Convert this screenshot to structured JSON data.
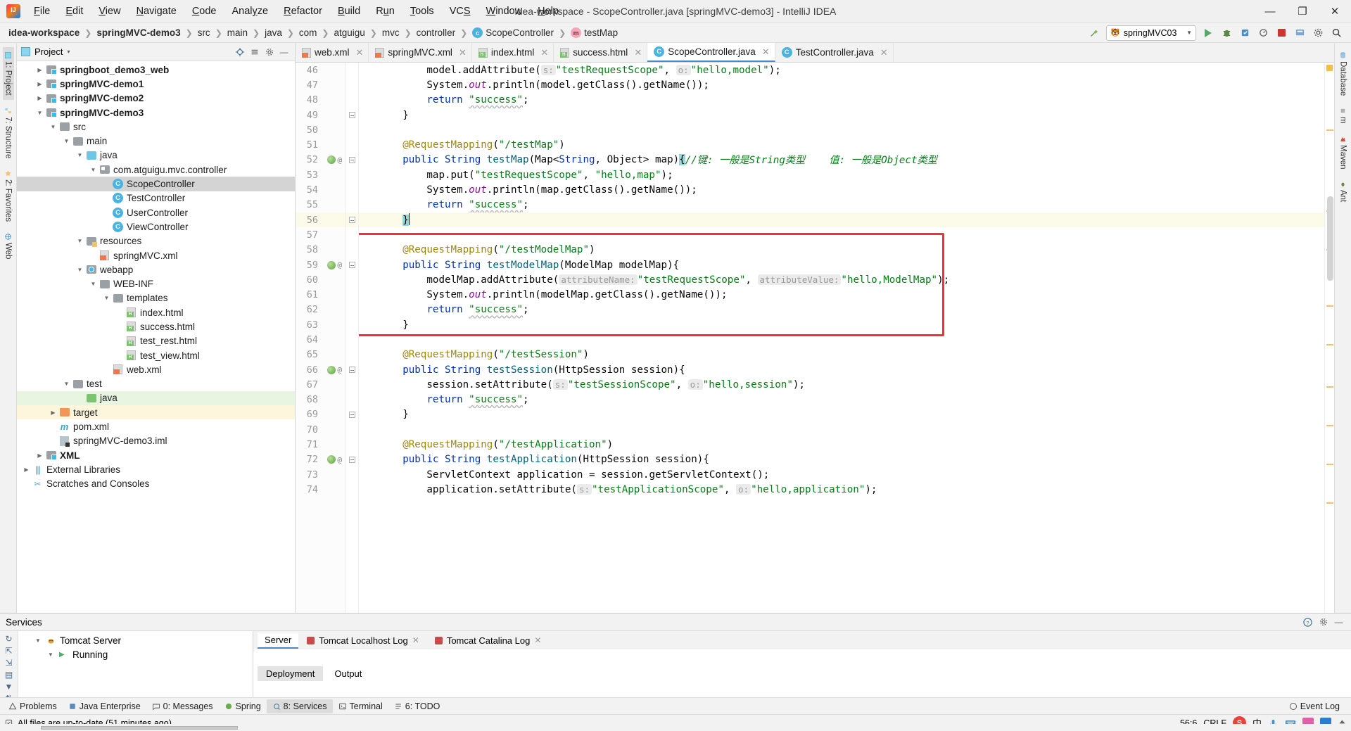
{
  "window": {
    "title": "idea-workspace - ScopeController.java [springMVC-demo3] - IntelliJ IDEA",
    "minimize": "—",
    "maximize": "❐",
    "close": "✕"
  },
  "menu": [
    {
      "label": "File"
    },
    {
      "label": "Edit"
    },
    {
      "label": "View"
    },
    {
      "label": "Navigate"
    },
    {
      "label": "Code"
    },
    {
      "label": "Analyze"
    },
    {
      "label": "Refactor"
    },
    {
      "label": "Build"
    },
    {
      "label": "Run"
    },
    {
      "label": "Tools"
    },
    {
      "label": "VCS"
    },
    {
      "label": "Window"
    },
    {
      "label": "Help"
    }
  ],
  "breadcrumb": [
    {
      "label": "idea-workspace",
      "bold": true,
      "icon": ""
    },
    {
      "label": "springMVC-demo3",
      "bold": true,
      "icon": ""
    },
    {
      "label": "src",
      "bold": false,
      "icon": ""
    },
    {
      "label": "main",
      "bold": false,
      "icon": ""
    },
    {
      "label": "java",
      "bold": false,
      "icon": ""
    },
    {
      "label": "com",
      "bold": false,
      "icon": ""
    },
    {
      "label": "atguigu",
      "bold": false,
      "icon": ""
    },
    {
      "label": "mvc",
      "bold": false,
      "icon": ""
    },
    {
      "label": "controller",
      "bold": false,
      "icon": ""
    },
    {
      "label": "ScopeController",
      "bold": false,
      "icon": "c"
    },
    {
      "label": "testMap",
      "bold": false,
      "icon": "m"
    }
  ],
  "toolbar": {
    "run_config": "springMVC03",
    "run_config_icon": "tomcat-icon",
    "build_icon": "hammer-icon",
    "run_icon": "run-button",
    "debug_icon": "debug-button",
    "coverage_icon": "coverage-button",
    "profile_icon": "profile-button",
    "stop_icon": "stop-button",
    "update_icon": "update-button",
    "settings_icon": "settings-button",
    "search_icon": "search-button"
  },
  "left_rail": [
    {
      "label": "1: Project",
      "active": true,
      "name": "tool-project"
    },
    {
      "label": "7: Structure",
      "active": false,
      "name": "tool-structure"
    },
    {
      "label": "2: Favorites",
      "active": false,
      "name": "tool-favorites"
    },
    {
      "label": "Web",
      "active": false,
      "name": "tool-web"
    }
  ],
  "right_rail": [
    {
      "label": "Database",
      "name": "tool-database"
    },
    {
      "label": "m",
      "name": "tool-m"
    },
    {
      "label": "Maven",
      "name": "tool-maven"
    },
    {
      "label": "Ant",
      "name": "tool-ant"
    }
  ],
  "project_panel": {
    "title": "Project",
    "caret": "▾",
    "tree": [
      {
        "label": "springboot_demo3_web",
        "indent": 1,
        "arrow": "▶",
        "icon": "module",
        "bold": true,
        "state": ""
      },
      {
        "label": "springMVC-demo1",
        "indent": 1,
        "arrow": "▶",
        "icon": "module",
        "bold": true,
        "state": ""
      },
      {
        "label": "springMVC-demo2",
        "indent": 1,
        "arrow": "▶",
        "icon": "module",
        "bold": true,
        "state": ""
      },
      {
        "label": "springMVC-demo3",
        "indent": 1,
        "arrow": "▼",
        "icon": "module",
        "bold": true,
        "state": ""
      },
      {
        "label": "src",
        "indent": 2,
        "arrow": "▼",
        "icon": "folder-gray",
        "bold": false,
        "state": ""
      },
      {
        "label": "main",
        "indent": 3,
        "arrow": "▼",
        "icon": "folder-gray",
        "bold": false,
        "state": ""
      },
      {
        "label": "java",
        "indent": 4,
        "arrow": "▼",
        "icon": "folder-blue",
        "bold": false,
        "state": ""
      },
      {
        "label": "com.atguigu.mvc.controller",
        "indent": 5,
        "arrow": "▼",
        "icon": "package",
        "bold": false,
        "state": ""
      },
      {
        "label": "ScopeController",
        "indent": 6,
        "arrow": "",
        "icon": "class",
        "bold": false,
        "state": "selected"
      },
      {
        "label": "TestController",
        "indent": 6,
        "arrow": "",
        "icon": "class",
        "bold": false,
        "state": ""
      },
      {
        "label": "UserController",
        "indent": 6,
        "arrow": "",
        "icon": "class",
        "bold": false,
        "state": ""
      },
      {
        "label": "ViewController",
        "indent": 6,
        "arrow": "",
        "icon": "class",
        "bold": false,
        "state": ""
      },
      {
        "label": "resources",
        "indent": 4,
        "arrow": "▼",
        "icon": "folder-res",
        "bold": false,
        "state": ""
      },
      {
        "label": "springMVC.xml",
        "indent": 5,
        "arrow": "",
        "icon": "xml-spring",
        "bold": false,
        "state": ""
      },
      {
        "label": "webapp",
        "indent": 4,
        "arrow": "▼",
        "icon": "folder-web",
        "bold": false,
        "state": ""
      },
      {
        "label": "WEB-INF",
        "indent": 5,
        "arrow": "▼",
        "icon": "folder-gray",
        "bold": false,
        "state": ""
      },
      {
        "label": "templates",
        "indent": 6,
        "arrow": "▼",
        "icon": "folder-gray",
        "bold": false,
        "state": ""
      },
      {
        "label": "index.html",
        "indent": 7,
        "arrow": "",
        "icon": "html",
        "bold": false,
        "state": ""
      },
      {
        "label": "success.html",
        "indent": 7,
        "arrow": "",
        "icon": "html",
        "bold": false,
        "state": ""
      },
      {
        "label": "test_rest.html",
        "indent": 7,
        "arrow": "",
        "icon": "html",
        "bold": false,
        "state": ""
      },
      {
        "label": "test_view.html",
        "indent": 7,
        "arrow": "",
        "icon": "html",
        "bold": false,
        "state": ""
      },
      {
        "label": "web.xml",
        "indent": 6,
        "arrow": "",
        "icon": "xml-web",
        "bold": false,
        "state": ""
      },
      {
        "label": "test",
        "indent": 3,
        "arrow": "▼",
        "icon": "folder-gray",
        "bold": false,
        "state": ""
      },
      {
        "label": "java",
        "indent": 4,
        "arrow": "",
        "icon": "folder-green",
        "bold": false,
        "state": "green"
      },
      {
        "label": "target",
        "indent": 2,
        "arrow": "▶",
        "icon": "folder-orange",
        "bold": false,
        "state": "yellow"
      },
      {
        "label": "pom.xml",
        "indent": 2,
        "arrow": "",
        "icon": "maven",
        "bold": false,
        "state": ""
      },
      {
        "label": "springMVC-demo3.iml",
        "indent": 2,
        "arrow": "",
        "icon": "iml",
        "bold": false,
        "state": ""
      },
      {
        "label": "XML",
        "indent": 1,
        "arrow": "▶",
        "icon": "module",
        "bold": true,
        "state": ""
      },
      {
        "label": "External Libraries",
        "indent": 0,
        "arrow": "▶",
        "icon": "library",
        "bold": false,
        "state": ""
      },
      {
        "label": "Scratches and Consoles",
        "indent": 0,
        "arrow": "",
        "icon": "scratch",
        "bold": false,
        "state": ""
      }
    ]
  },
  "editor_tabs": [
    {
      "label": "web.xml",
      "icon": "xml-web",
      "active": false
    },
    {
      "label": "springMVC.xml",
      "icon": "xml-spring",
      "active": false
    },
    {
      "label": "index.html",
      "icon": "html",
      "active": false
    },
    {
      "label": "success.html",
      "icon": "html",
      "active": false
    },
    {
      "label": "ScopeController.java",
      "icon": "class",
      "active": true
    },
    {
      "label": "TestController.java",
      "icon": "class",
      "active": false
    }
  ],
  "code": {
    "first_line": 46,
    "lines": [
      {
        "n": 46,
        "text": "        model.addAttribute( s: \"testRequestScope\",  o: \"hello,model\");"
      },
      {
        "n": 47,
        "text": "        System.out.println(model.getClass().getName());"
      },
      {
        "n": 48,
        "text": "        return \"success\";"
      },
      {
        "n": 49,
        "text": "    }"
      },
      {
        "n": 50,
        "text": ""
      },
      {
        "n": 51,
        "text": "    @RequestMapping(\"/testMap\")"
      },
      {
        "n": 52,
        "text": "    public String testMap(Map<String, Object> map){//键: 一般是String类型    值: 一般是Object类型"
      },
      {
        "n": 53,
        "text": "        map.put(\"testRequestScope\", \"hello,map\");"
      },
      {
        "n": 54,
        "text": "        System.out.println(map.getClass().getName());"
      },
      {
        "n": 55,
        "text": "        return \"success\";"
      },
      {
        "n": 56,
        "text": "    }"
      },
      {
        "n": 57,
        "text": ""
      },
      {
        "n": 58,
        "text": "    @RequestMapping(\"/testModelMap\")"
      },
      {
        "n": 59,
        "text": "    public String testModelMap(ModelMap modelMap){"
      },
      {
        "n": 60,
        "text": "        modelMap.addAttribute( attributeName: \"testRequestScope\",  attributeValue: \"hello,ModelMap\");"
      },
      {
        "n": 61,
        "text": "        System.out.println(modelMap.getClass().getName());"
      },
      {
        "n": 62,
        "text": "        return \"success\";"
      },
      {
        "n": 63,
        "text": "    }"
      },
      {
        "n": 64,
        "text": ""
      },
      {
        "n": 65,
        "text": "    @RequestMapping(\"/testSession\")"
      },
      {
        "n": 66,
        "text": "    public String testSession(HttpSession session){"
      },
      {
        "n": 67,
        "text": "        session.setAttribute( s: \"testSessionScope\",  o: \"hello,session\");"
      },
      {
        "n": 68,
        "text": "        return \"success\";"
      },
      {
        "n": 69,
        "text": "    }"
      },
      {
        "n": 70,
        "text": ""
      },
      {
        "n": 71,
        "text": "    @RequestMapping(\"/testApplication\")"
      },
      {
        "n": 72,
        "text": "    public String testApplication(HttpSession session){"
      },
      {
        "n": 73,
        "text": "        ServletContext application = session.getServletContext();"
      },
      {
        "n": 74,
        "text": "        application.setAttribute( s: \"testApplicationScope\",  o: \"hello,application\");"
      }
    ],
    "bean_lines": [
      52,
      59,
      66,
      72
    ],
    "fold_lines": [
      49,
      52,
      56,
      59,
      66,
      69,
      72
    ],
    "highlight_line": 56,
    "annotation_box_label": "red-highlight-box",
    "annotation_box_color": "#e8343a"
  },
  "services": {
    "title": "Services",
    "settings_icon": "gear-icon",
    "help_icon": "help-icon",
    "hide_icon": "hide-icon",
    "tree": [
      {
        "label": "Tomcat Server",
        "indent": 1,
        "arrow": "▼",
        "icon": "tomcat"
      },
      {
        "label": "Running",
        "indent": 2,
        "arrow": "▼",
        "icon": "run"
      }
    ],
    "tabs": [
      {
        "label": "Server",
        "active": true,
        "closable": false
      },
      {
        "label": "Tomcat Localhost Log",
        "active": false,
        "closable": true
      },
      {
        "label": "Tomcat Catalina Log",
        "active": false,
        "closable": true
      }
    ],
    "subtabs": [
      {
        "label": "Deployment",
        "active": true
      },
      {
        "label": "Output",
        "active": false
      }
    ],
    "toolbar_icons": [
      "rerun-icon",
      "expand-icon",
      "collapse-icon",
      "group-icon",
      "filter-icon",
      "sort-icon",
      "add-icon"
    ]
  },
  "bottom_bar": {
    "items": [
      {
        "label": "Problems",
        "icon": "warning-icon",
        "active": false
      },
      {
        "label": "Java Enterprise",
        "icon": "java-icon",
        "active": false
      },
      {
        "label": "0: Messages",
        "icon": "messages-icon",
        "active": false
      },
      {
        "label": "Spring",
        "icon": "spring-icon",
        "active": false
      },
      {
        "label": "8: Services",
        "icon": "services-icon",
        "active": true
      },
      {
        "label": "Terminal",
        "icon": "terminal-icon",
        "active": false
      },
      {
        "label": "6: TODO",
        "icon": "todo-icon",
        "active": false
      }
    ],
    "event_log": "Event Log",
    "event_log_icon": "event-log-icon"
  },
  "statusbar": {
    "message": "All files are up-to-date (51 minutes ago)",
    "message_icon": "sync-icon",
    "caret_position": "56:6",
    "line_separator": "CRLF",
    "ime_label": "中",
    "icons": [
      "sogou-icon",
      "ime-icon",
      "keyboard-icon",
      "mic-icon",
      "tray-icon",
      "color-icon",
      "arrow-icon"
    ]
  }
}
